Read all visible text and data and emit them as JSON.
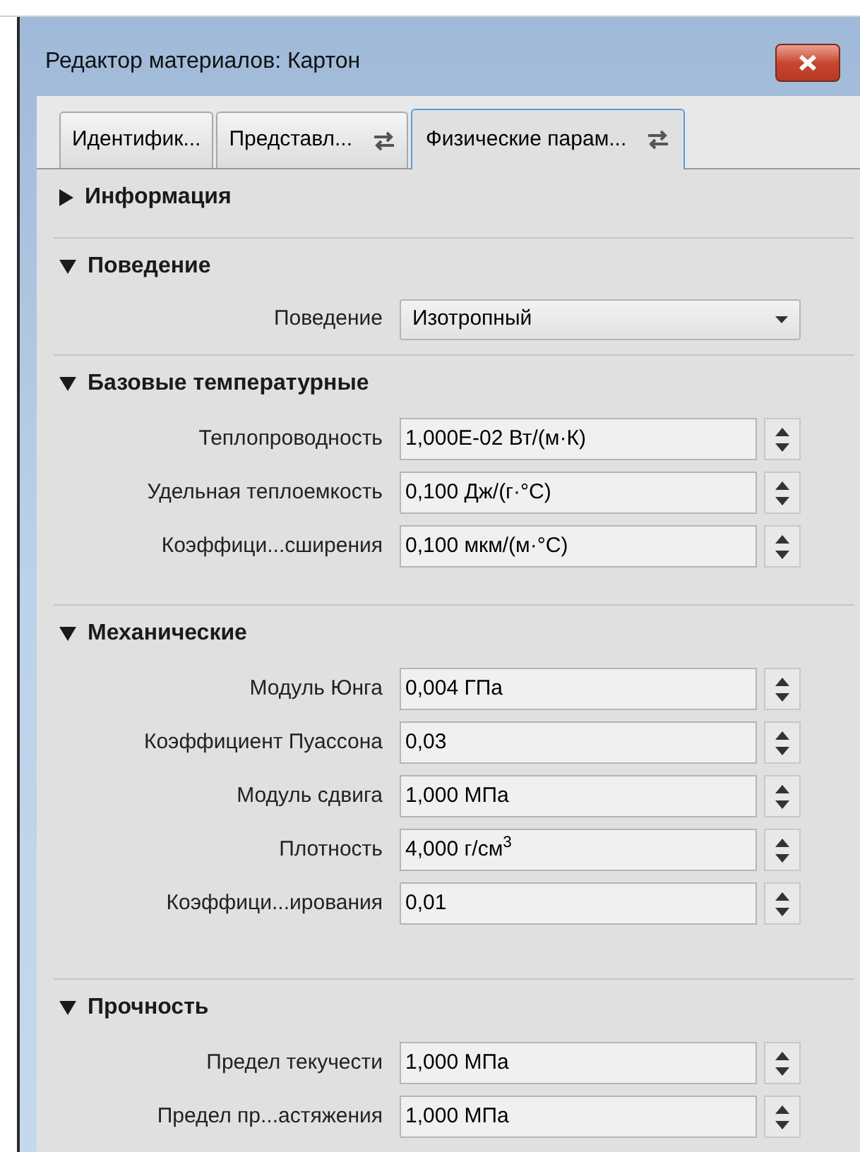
{
  "window": {
    "title": "Редактор материалов: Картон"
  },
  "tabs": [
    {
      "label": "Идентифик...",
      "selected": false,
      "linked": false
    },
    {
      "label": "Представл...",
      "selected": false,
      "linked": true
    },
    {
      "label": "Физические парам...",
      "selected": true,
      "linked": true
    }
  ],
  "sections": [
    {
      "title": "Информация",
      "expanded": false
    },
    {
      "title": "Поведение",
      "expanded": true,
      "rows": [
        {
          "kind": "dropdown",
          "label": "Поведение",
          "value": "Изотропный"
        }
      ]
    },
    {
      "title": "Базовые температурные",
      "expanded": true,
      "rows": [
        {
          "kind": "spinner",
          "label": "Теплопроводность",
          "value": "1,000E-02 Вт/(м·К)"
        },
        {
          "kind": "spinner",
          "label": "Удельная теплоемкость",
          "value": "0,100 Дж/(г·°C)"
        },
        {
          "kind": "spinner",
          "label": "Коэффици...сширения",
          "value": "0,100 мкм/(м·°C)"
        }
      ]
    },
    {
      "title": "Механические",
      "expanded": true,
      "rows": [
        {
          "kind": "spinner",
          "label": "Модуль Юнга",
          "value": "0,004 ГПа"
        },
        {
          "kind": "spinner",
          "label": "Коэффициент Пуассона",
          "value": "0,03"
        },
        {
          "kind": "spinner",
          "label": "Модуль сдвига",
          "value": "1,000 МПа"
        },
        {
          "kind": "spinner",
          "label": "Плотность",
          "value": "4,000 г/см$^{3}$"
        },
        {
          "kind": "spinner",
          "label": "Коэффици...ирования",
          "value": "0,01"
        }
      ]
    },
    {
      "title": "Прочность",
      "expanded": true,
      "rows": [
        {
          "kind": "spinner",
          "label": "Предел текучести",
          "value": "1,000 МПа"
        },
        {
          "kind": "spinner",
          "label": "Предел пр...астяжения",
          "value": "1,000 МПа"
        }
      ]
    }
  ]
}
